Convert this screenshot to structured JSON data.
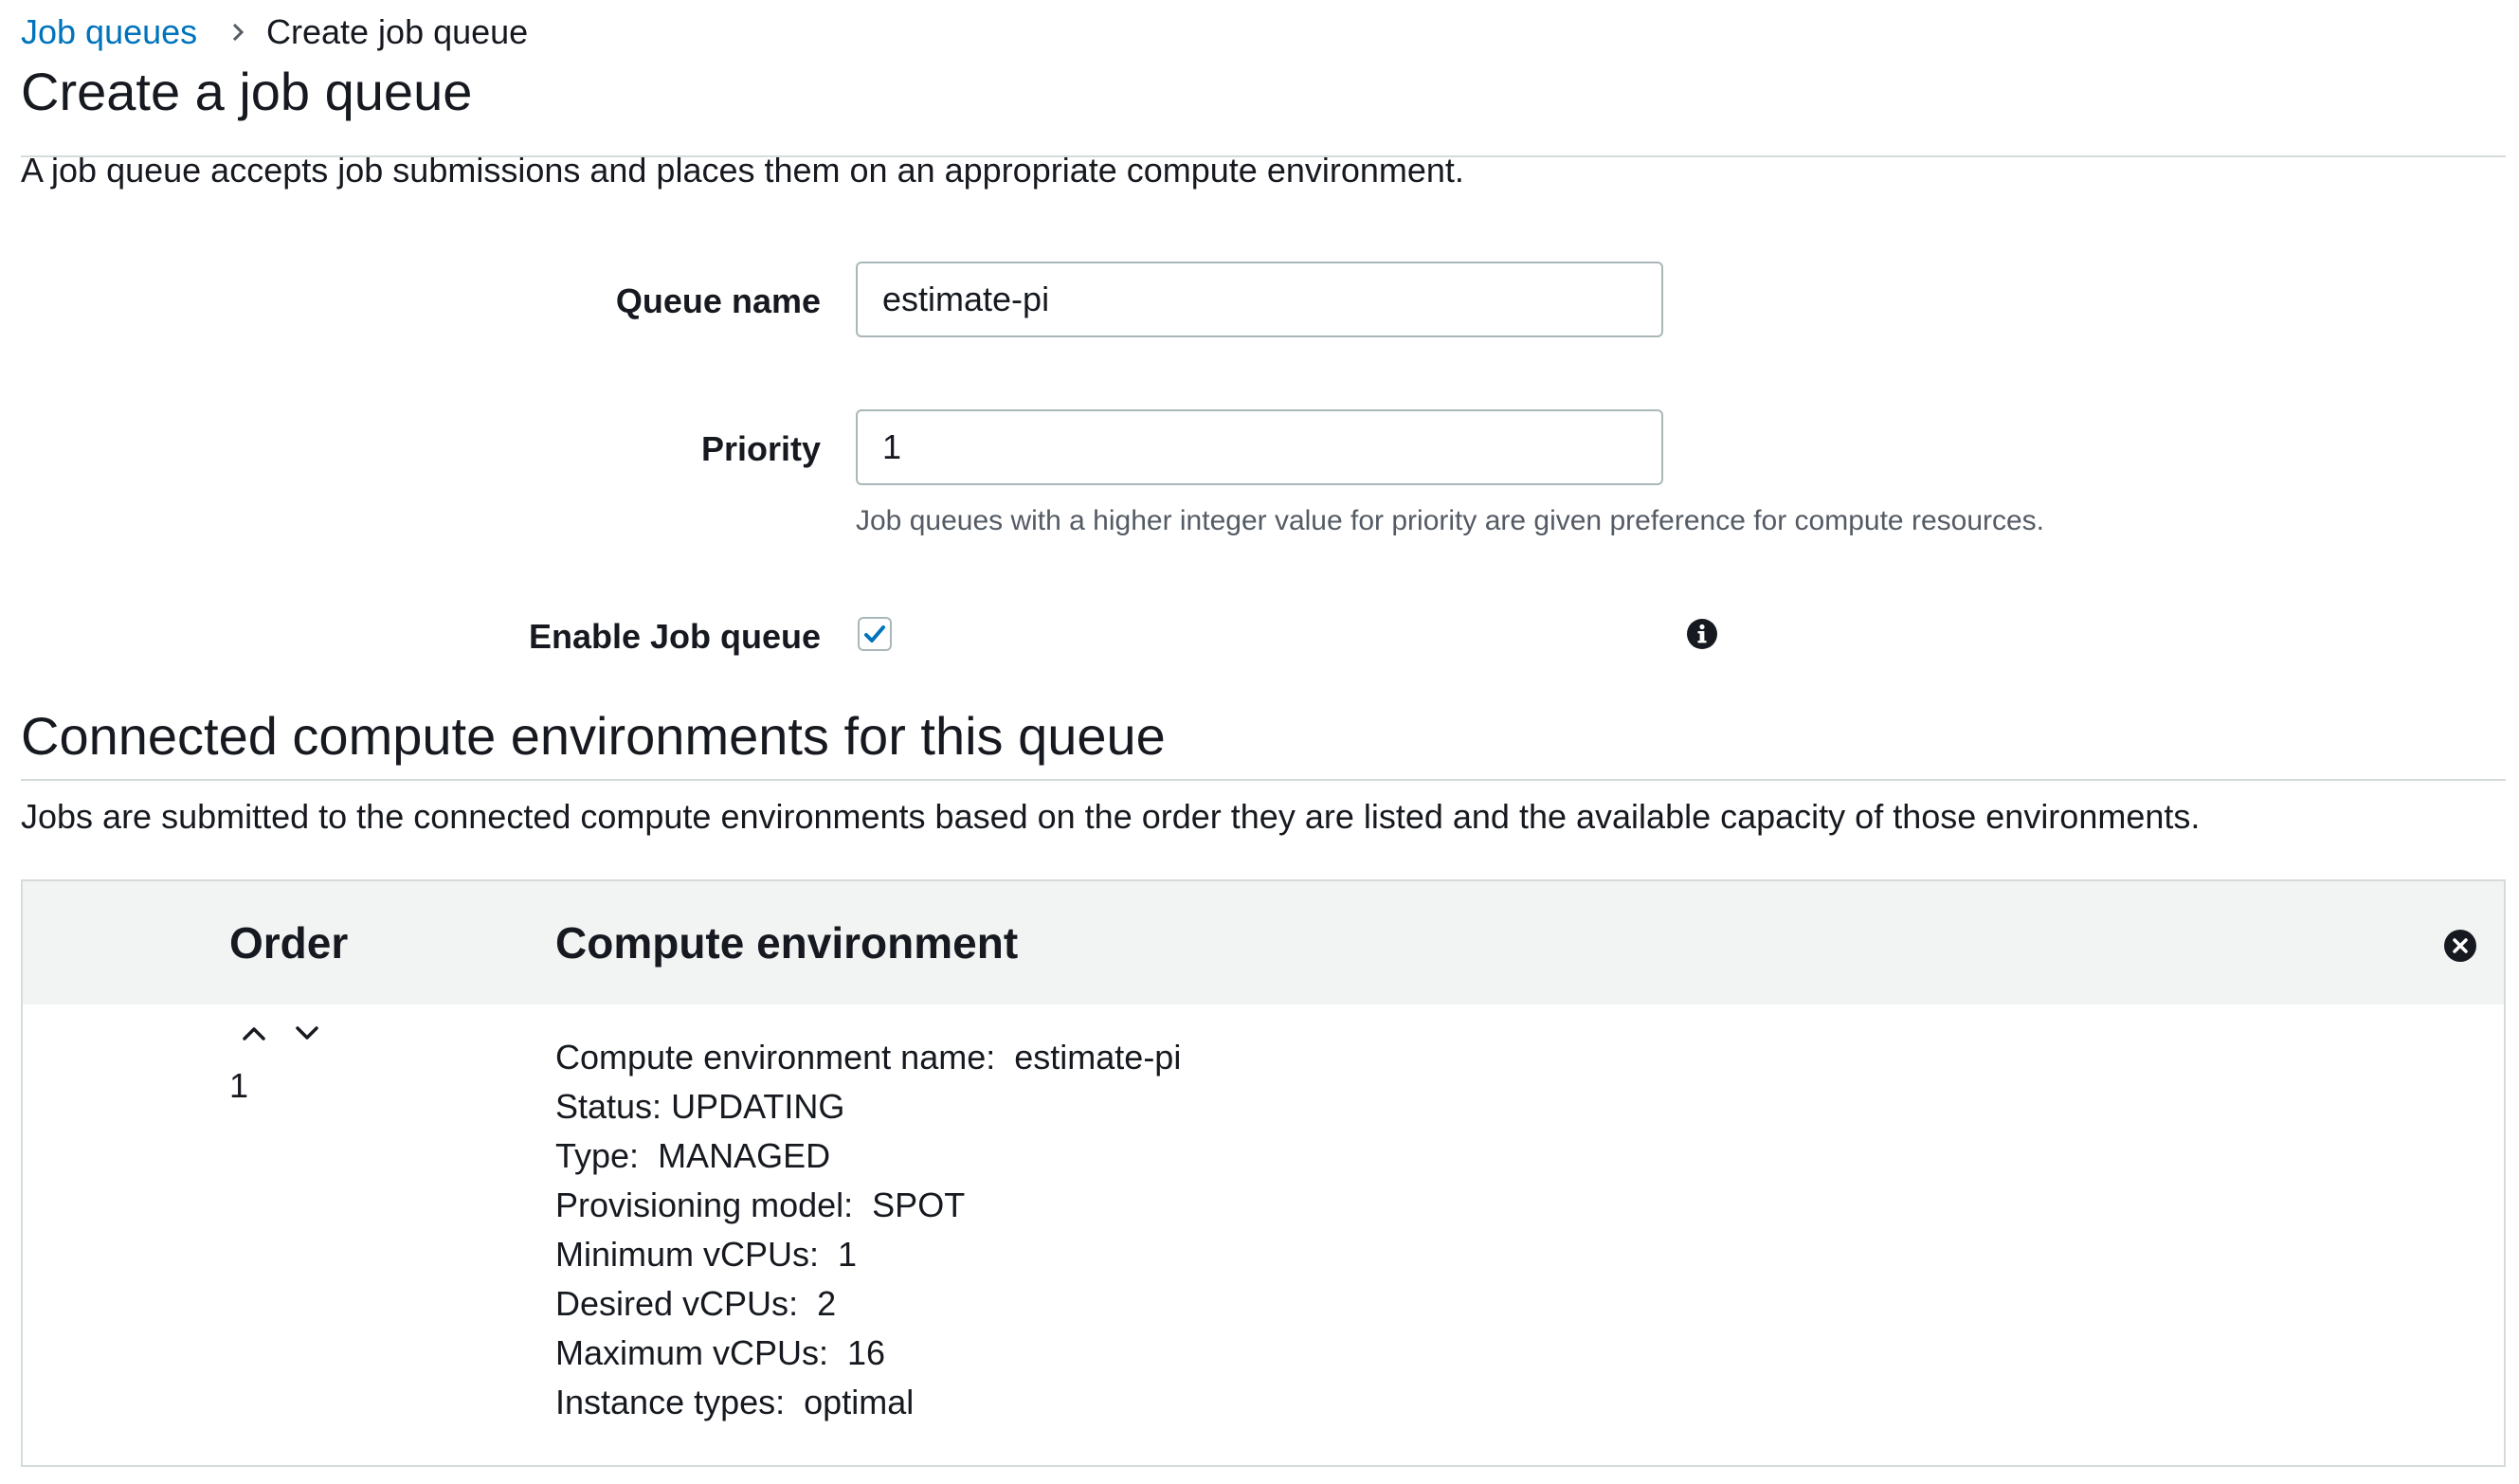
{
  "breadcrumb": {
    "parent": "Job queues",
    "current": "Create job queue"
  },
  "page": {
    "title": "Create a job queue",
    "description": "A job queue accepts job submissions and places them on an appropriate compute environment."
  },
  "form": {
    "queue_name": {
      "label": "Queue name",
      "value": "estimate-pi"
    },
    "priority": {
      "label": "Priority",
      "value": "1",
      "hint": "Job queues with a higher integer value for priority are given preference for compute resources."
    },
    "enable": {
      "label": "Enable Job queue",
      "checked": true,
      "info_icon": "info-icon"
    }
  },
  "environments_section": {
    "title": "Connected compute environments for this queue",
    "description": "Jobs are submitted to the connected compute environments based on the order they are listed and the available capacity of those environments.",
    "columns": {
      "order": "Order",
      "environment": "Compute environment"
    },
    "rows": [
      {
        "order": "1",
        "details": [
          {
            "key": "Compute environment name",
            "value": "estimate-pi"
          },
          {
            "key": "Status",
            "value": "UPDATING"
          },
          {
            "key": "Type",
            "value": "MANAGED"
          },
          {
            "key": "Provisioning model",
            "value": "SPOT"
          },
          {
            "key": "Minimum vCPUs",
            "value": "1"
          },
          {
            "key": "Desired vCPUs",
            "value": "2"
          },
          {
            "key": "Maximum vCPUs",
            "value": "16"
          },
          {
            "key": "Instance types",
            "value": "optimal"
          }
        ]
      }
    ]
  },
  "colors": {
    "link": "#0073bb",
    "checkbox_check": "#0073bb",
    "header_bg": "#f2f3f3",
    "border": "#aab7b8"
  }
}
